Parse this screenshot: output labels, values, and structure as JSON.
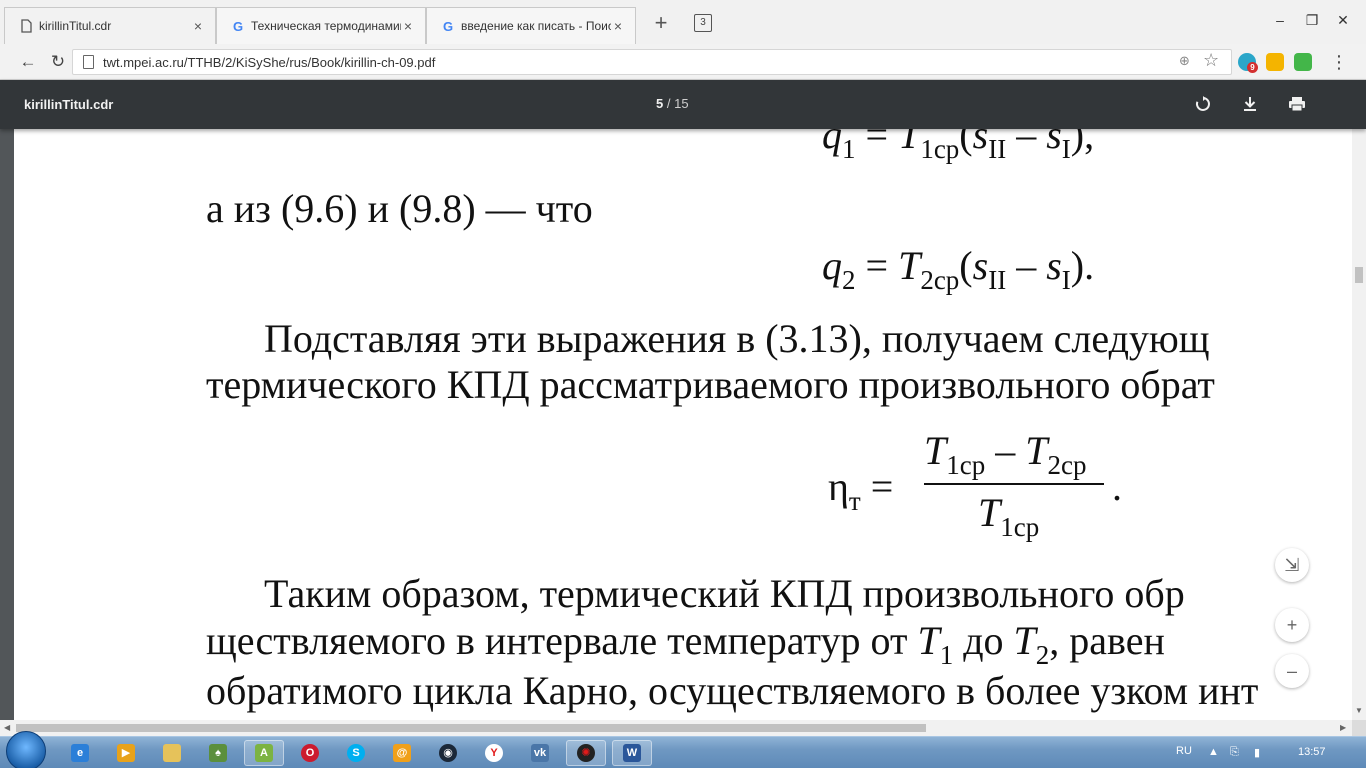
{
  "browser": {
    "tabs": [
      {
        "title": "kirillinTitul.cdr",
        "favicon": "document-icon",
        "active": true
      },
      {
        "title": "Техническая термодинамика -",
        "favicon": "google-g-icon",
        "active": false
      },
      {
        "title": "введение как писать - Поиск в",
        "favicon": "google-g-icon",
        "active": false
      }
    ],
    "tab_count_badge": "3",
    "url": "twt.mpei.ac.ru/TTHB/2/KiSyShe/rus/Book/kirillin-ch-09.pdf",
    "extension_badge": "9"
  },
  "pdf_toolbar": {
    "title": "kirillinTitul.cdr",
    "page_current": "5",
    "page_separator": "/",
    "page_total": "15"
  },
  "pdf_content": {
    "line1_text": "а из (9.6) и (9.8) — что",
    "line2_text": "Подставляя эти выражения в (3.13), получаем следующ",
    "line3_text": "термического КПД рассматриваемого произвольного обрат",
    "line4_text": "Таким образом, термический КПД произвольного обр",
    "line5_prefix": "осуществляемого в интервале температур от",
    "line5_text_a": "ществляемого в интервале температур от ",
    "line5_text_b": " до ",
    "line5_text_c": ", равен",
    "line6_text": "обратимого цикла Карно, осуществляемого в более узком инт",
    "formula_q1": {
      "lhs": "q",
      "lhs_sub": "1",
      "T": "T",
      "T_sub": "1ср",
      "s": "s",
      "s1_sub": "II",
      "minus": " – ",
      "s2_sub": "I",
      "tail": "),"
    },
    "formula_q2": {
      "lhs": "q",
      "lhs_sub": "2",
      "T": "T",
      "T_sub": "2ср",
      "s": "s",
      "s1_sub": "II",
      "minus": " – ",
      "s2_sub": "I",
      "tail": ")."
    },
    "formula_eta": {
      "eta": "η",
      "eta_sub": "т",
      "equals": "=",
      "num_T1": "T",
      "num_T1_sub": "1ср",
      "num_minus": " – ",
      "num_T2": "T",
      "num_T2_sub": "2ср",
      "den_T": "T",
      "den_sub": "1ср",
      "end": "."
    },
    "T1_sym": "T",
    "T1_sub": "1",
    "T2_sym": "T",
    "T2_sub": "2"
  },
  "zoom_controls": {
    "fit": "fit-page-icon",
    "plus": "+",
    "minus": "–"
  },
  "taskbar": {
    "language": "RU",
    "clock": "13:57",
    "pinned": [
      "ie-icon",
      "media-player-icon",
      "folder-icon",
      "games-icon",
      "android-icon",
      "opera-icon",
      "skype-icon",
      "mail-icon",
      "steam-icon",
      "yandex-icon",
      "vk-icon",
      "media-icon",
      "word-icon"
    ]
  },
  "colors": {
    "pdf_toolbar_bg": "#323639",
    "pdf_bg": "#525659",
    "taskbar": "#6f98c2"
  }
}
